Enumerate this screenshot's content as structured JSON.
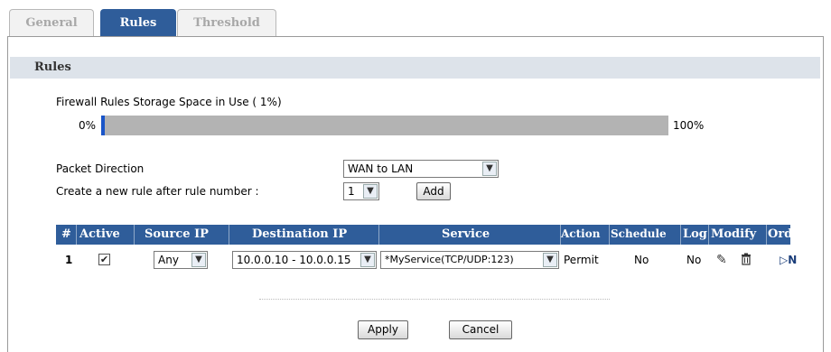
{
  "tabs": [
    {
      "label": "General",
      "active": false
    },
    {
      "label": "Rules",
      "active": true
    },
    {
      "label": "Threshold",
      "active": false
    }
  ],
  "section_title": "Rules",
  "storage": {
    "label": "Firewall Rules Storage Space in Use",
    "percent_text": "( 1%)",
    "min_label": "0%",
    "max_label": "100%",
    "percent": 1
  },
  "packet_direction": {
    "label": "Packet Direction",
    "value": "WAN to LAN"
  },
  "new_rule": {
    "label": "Create a new rule after rule number :",
    "value": "1",
    "add_label": "Add"
  },
  "table": {
    "headers": [
      "#",
      "Active",
      "Source IP",
      "Destination IP",
      "Service",
      "Action",
      "Schedule",
      "Log",
      "Modify",
      "Order"
    ],
    "rows": [
      {
        "num": "1",
        "active": true,
        "source_ip": "Any",
        "destination_ip": "10.0.0.10 - 10.0.0.15",
        "service": "*MyService(TCP/UDP:123)",
        "action": "Permit",
        "schedule": "No",
        "log": "No"
      }
    ]
  },
  "buttons": {
    "apply": "Apply",
    "cancel": "Cancel"
  },
  "colors": {
    "accent": "#2f5d9a",
    "progress_fill": "#1a55c8",
    "section_bar": "#dde3ea"
  }
}
